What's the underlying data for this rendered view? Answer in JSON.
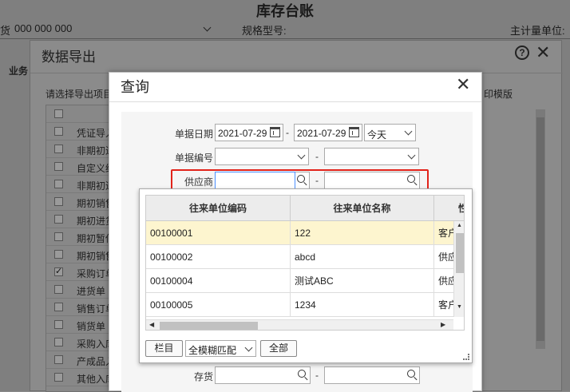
{
  "background": {
    "title": "库存台账",
    "filters": [
      "货",
      "000 000 000",
      "规格型号:",
      "主计量单位:"
    ],
    "business_label": "业务"
  },
  "export_dialog": {
    "title": "数据导出",
    "select_label": "请选择导出项目",
    "print_template_label": "印模版",
    "items": [
      {
        "label": "",
        "checked": false
      },
      {
        "label": "凭证导入",
        "checked": false
      },
      {
        "label": "非期初进",
        "checked": false
      },
      {
        "label": "自定义结",
        "checked": false
      },
      {
        "label": "非期初进",
        "checked": false
      },
      {
        "label": "期初销售",
        "checked": false
      },
      {
        "label": "期初进货",
        "checked": false
      },
      {
        "label": "期初暂估",
        "checked": false
      },
      {
        "label": "期初销售",
        "checked": false
      },
      {
        "label": "采购订单",
        "checked": true
      },
      {
        "label": "进货单",
        "checked": false
      },
      {
        "label": "销售订单",
        "checked": false
      },
      {
        "label": "销货单",
        "checked": false
      },
      {
        "label": "采购入库",
        "checked": false
      },
      {
        "label": "产成品入",
        "checked": false
      },
      {
        "label": "其他入库",
        "checked": false
      }
    ]
  },
  "query_dialog": {
    "title": "查询",
    "close": "✕",
    "date_label": "单据日期",
    "date_from": "2021-07-29",
    "date_to": "2021-07-29",
    "date_preset": "今天",
    "docno_label": "单据编号",
    "supplier_label": "供应商",
    "stock_label": "存货",
    "dash": "-"
  },
  "supplier_popup": {
    "columns": [
      "往来单位编码",
      "往来单位名称",
      "性"
    ],
    "rows": [
      {
        "code": "00100001",
        "name": "122",
        "extra": "客户"
      },
      {
        "code": "00100002",
        "name": "abcd",
        "extra": "供应"
      },
      {
        "code": "00100004",
        "name": "测试ABC",
        "extra": "供应"
      },
      {
        "code": "00100005",
        "name": "1234",
        "extra": "客户"
      }
    ],
    "selected_row": 0,
    "columns_button": "栏目",
    "match_mode": "全模糊匹配",
    "all_button": "全部"
  }
}
